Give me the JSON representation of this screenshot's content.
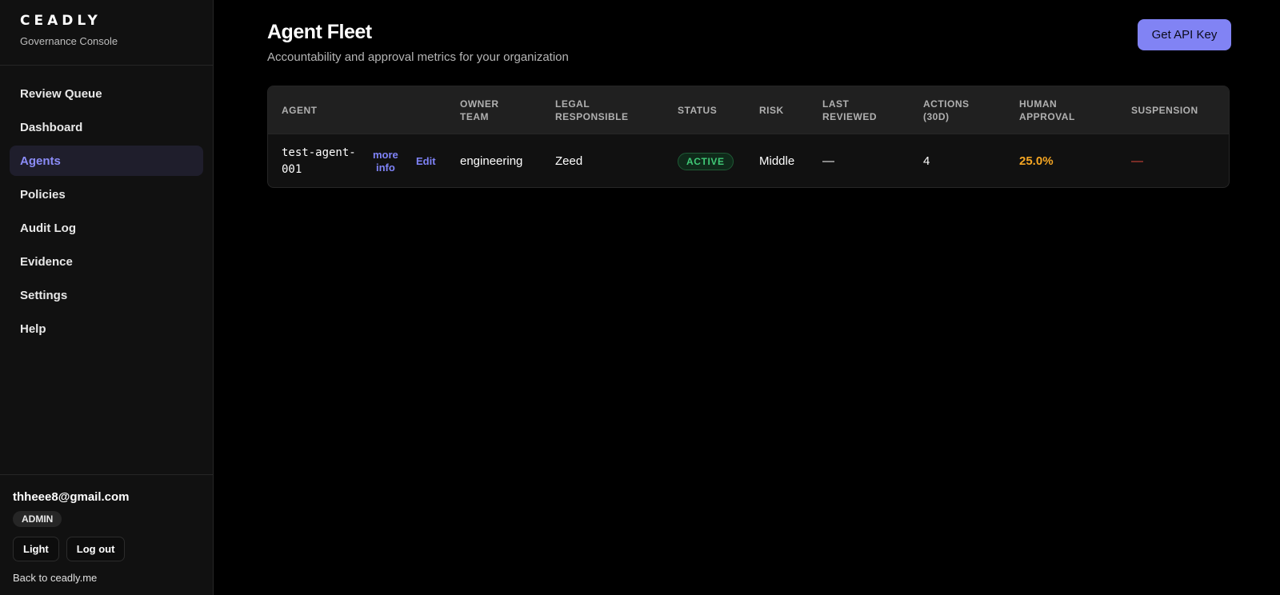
{
  "brand": {
    "logo": "CEADLY",
    "subtitle": "Governance Console"
  },
  "nav": {
    "items": [
      {
        "label": "Review Queue"
      },
      {
        "label": "Dashboard"
      },
      {
        "label": "Agents",
        "active": true
      },
      {
        "label": "Policies"
      },
      {
        "label": "Audit Log"
      },
      {
        "label": "Evidence"
      },
      {
        "label": "Settings"
      },
      {
        "label": "Help"
      }
    ]
  },
  "user": {
    "email": "thheee8@gmail.com",
    "role": "ADMIN",
    "theme_button": "Light",
    "logout_button": "Log out",
    "back_link": "Back to ceadly.me"
  },
  "header": {
    "title": "Agent Fleet",
    "subtitle": "Accountability and approval metrics for your organization",
    "api_button": "Get API Key"
  },
  "table": {
    "columns": [
      {
        "line1": "AGENT",
        "line2": ""
      },
      {
        "line1": "OWNER",
        "line2": "TEAM"
      },
      {
        "line1": "LEGAL",
        "line2": "RESPONSIBLE"
      },
      {
        "line1": "STATUS",
        "line2": ""
      },
      {
        "line1": "RISK",
        "line2": ""
      },
      {
        "line1": "LAST",
        "line2": "REVIEWED"
      },
      {
        "line1": "ACTIONS",
        "line2": "(30D)"
      },
      {
        "line1": "HUMAN",
        "line2": "APPROVAL"
      },
      {
        "line1": "SUSPENSION",
        "line2": ""
      }
    ],
    "rows": [
      {
        "agent_line1": "test-agent-",
        "agent_line2": "001",
        "more_info_line1": "more",
        "more_info_line2": "info",
        "edit": "Edit",
        "owner_team": "engineering",
        "legal_responsible": "Zeed",
        "status": "ACTIVE",
        "risk": "Middle",
        "last_reviewed": "—",
        "actions_30d": "4",
        "human_approval": "25.0%",
        "suspension": "—"
      }
    ]
  },
  "colors": {
    "accent": "#8183f4",
    "active_nav_text": "#8b8cf8",
    "status_active": "#40c977",
    "approval_warning": "#f5a623",
    "suspension_red": "#e0473b"
  }
}
